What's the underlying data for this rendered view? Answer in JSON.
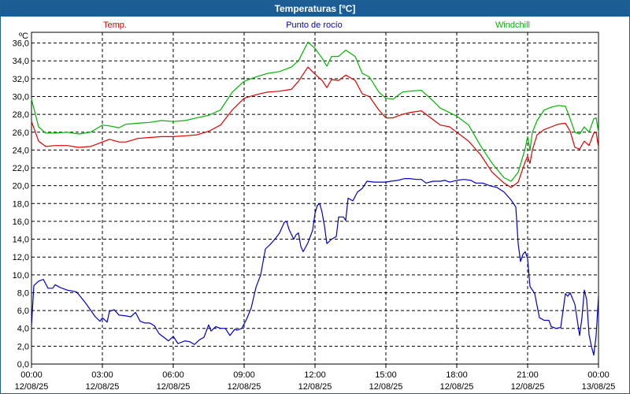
{
  "title": "Temperaturas [ºC]",
  "chart_data": {
    "type": "line",
    "yunit": "ºC",
    "ylim": [
      0,
      37.2
    ],
    "yticks": [
      "0,0",
      "2,0",
      "4,0",
      "6,0",
      "8,0",
      "10,0",
      "12,0",
      "14,0",
      "16,0",
      "18,0",
      "20,0",
      "22,0",
      "24,0",
      "26,0",
      "28,0",
      "30,0",
      "32,0",
      "34,0",
      "36,0"
    ],
    "xticks": [
      {
        "time": "00:00",
        "date": "12/08/25"
      },
      {
        "time": "03:00",
        "date": "12/08/25"
      },
      {
        "time": "06:00",
        "date": "12/08/25"
      },
      {
        "time": "09:00",
        "date": "12/08/25"
      },
      {
        "time": "12:00",
        "date": "12/08/25"
      },
      {
        "time": "15:00",
        "date": "12/08/25"
      },
      {
        "time": "18:00",
        "date": "12/08/25"
      },
      {
        "time": "21:00",
        "date": "12/08/25"
      },
      {
        "time": "00:00",
        "date": "13/08/25"
      }
    ],
    "xlim_hours": [
      0,
      24
    ],
    "grid": true,
    "series": [
      {
        "name": "Temp.",
        "color": "#e00000",
        "points": [
          [
            0,
            27.2
          ],
          [
            0.3,
            25.0
          ],
          [
            0.6,
            24.4
          ],
          [
            1.0,
            24.5
          ],
          [
            1.5,
            24.5
          ],
          [
            2.0,
            24.3
          ],
          [
            2.5,
            24.4
          ],
          [
            3.0,
            24.9
          ],
          [
            3.3,
            25.2
          ],
          [
            3.7,
            24.9
          ],
          [
            4.0,
            24.9
          ],
          [
            4.5,
            25.3
          ],
          [
            5.0,
            25.4
          ],
          [
            5.5,
            25.5
          ],
          [
            6.0,
            25.5
          ],
          [
            6.5,
            25.6
          ],
          [
            7.0,
            25.7
          ],
          [
            7.5,
            26.1
          ],
          [
            8.0,
            26.8
          ],
          [
            8.5,
            28.5
          ],
          [
            9.0,
            29.8
          ],
          [
            9.5,
            30.2
          ],
          [
            10.0,
            30.5
          ],
          [
            10.5,
            30.6
          ],
          [
            11.0,
            30.8
          ],
          [
            11.3,
            31.7
          ],
          [
            11.7,
            33.3
          ],
          [
            12.0,
            32.5
          ],
          [
            12.3,
            31.8
          ],
          [
            12.5,
            31.0
          ],
          [
            12.7,
            31.9
          ],
          [
            13.0,
            31.8
          ],
          [
            13.3,
            32.4
          ],
          [
            13.7,
            31.8
          ],
          [
            14.0,
            30.3
          ],
          [
            14.3,
            30.0
          ],
          [
            14.7,
            28.5
          ],
          [
            15.0,
            27.6
          ],
          [
            15.3,
            27.6
          ],
          [
            15.7,
            28.0
          ],
          [
            16.0,
            28.2
          ],
          [
            16.5,
            28.4
          ],
          [
            17.0,
            27.4
          ],
          [
            17.3,
            26.8
          ],
          [
            17.7,
            26.6
          ],
          [
            18.0,
            26.0
          ],
          [
            18.5,
            25.0
          ],
          [
            19.0,
            23.5
          ],
          [
            19.5,
            21.5
          ],
          [
            20.0,
            20.3
          ],
          [
            20.3,
            19.8
          ],
          [
            20.6,
            20.4
          ],
          [
            20.9,
            22.7
          ],
          [
            21.0,
            23.3
          ],
          [
            21.1,
            22.5
          ],
          [
            21.2,
            24.0
          ],
          [
            21.4,
            25.7
          ],
          [
            21.7,
            26.3
          ],
          [
            22.0,
            26.6
          ],
          [
            22.3,
            26.9
          ],
          [
            22.6,
            27.0
          ],
          [
            22.8,
            26.1
          ],
          [
            23.0,
            24.3
          ],
          [
            23.2,
            24.1
          ],
          [
            23.4,
            25.0
          ],
          [
            23.6,
            24.5
          ],
          [
            23.8,
            25.9
          ],
          [
            23.9,
            26.0
          ],
          [
            24.0,
            24.3
          ]
        ]
      },
      {
        "name": "Punto de rocío",
        "color": "#0000c8",
        "points": [
          [
            0,
            4.3
          ],
          [
            0.1,
            8.8
          ],
          [
            0.3,
            9.3
          ],
          [
            0.5,
            9.5
          ],
          [
            0.7,
            8.5
          ],
          [
            0.9,
            8.5
          ],
          [
            1.0,
            8.9
          ],
          [
            1.2,
            8.6
          ],
          [
            1.5,
            8.3
          ],
          [
            1.9,
            8.1
          ],
          [
            2.0,
            7.8
          ],
          [
            2.3,
            6.8
          ],
          [
            2.7,
            5.3
          ],
          [
            2.9,
            4.8
          ],
          [
            3.0,
            5.2
          ],
          [
            3.2,
            4.7
          ],
          [
            3.3,
            5.9
          ],
          [
            3.5,
            6.1
          ],
          [
            3.7,
            5.5
          ],
          [
            4.0,
            5.4
          ],
          [
            4.2,
            5.3
          ],
          [
            4.4,
            5.8
          ],
          [
            4.6,
            4.8
          ],
          [
            4.8,
            4.6
          ],
          [
            5.0,
            4.6
          ],
          [
            5.2,
            4.3
          ],
          [
            5.4,
            3.4
          ],
          [
            5.6,
            3.0
          ],
          [
            5.8,
            2.6
          ],
          [
            6.0,
            3.1
          ],
          [
            6.2,
            2.3
          ],
          [
            6.5,
            2.6
          ],
          [
            6.7,
            2.5
          ],
          [
            6.9,
            2.2
          ],
          [
            7.1,
            2.7
          ],
          [
            7.3,
            3.0
          ],
          [
            7.5,
            4.4
          ],
          [
            7.6,
            3.7
          ],
          [
            7.8,
            4.2
          ],
          [
            8.0,
            4.0
          ],
          [
            8.2,
            4.0
          ],
          [
            8.4,
            3.2
          ],
          [
            8.6,
            3.9
          ],
          [
            8.7,
            3.8
          ],
          [
            8.9,
            4.0
          ],
          [
            9.1,
            5.0
          ],
          [
            9.3,
            6.3
          ],
          [
            9.5,
            8.6
          ],
          [
            9.7,
            10.0
          ],
          [
            9.9,
            12.9
          ],
          [
            10.1,
            13.4
          ],
          [
            10.3,
            14.0
          ],
          [
            10.5,
            14.7
          ],
          [
            10.7,
            15.9
          ],
          [
            10.8,
            16.0
          ],
          [
            10.9,
            15.1
          ],
          [
            11.1,
            14.0
          ],
          [
            11.2,
            14.5
          ],
          [
            11.3,
            14.7
          ],
          [
            11.4,
            13.2
          ],
          [
            11.5,
            12.6
          ],
          [
            11.7,
            13.6
          ],
          [
            11.9,
            15.0
          ],
          [
            12.0,
            16.9
          ],
          [
            12.1,
            17.8
          ],
          [
            12.2,
            18.0
          ],
          [
            12.3,
            17.0
          ],
          [
            12.4,
            15.5
          ],
          [
            12.5,
            13.5
          ],
          [
            12.7,
            14.0
          ],
          [
            12.9,
            14.3
          ],
          [
            13.0,
            16.5
          ],
          [
            13.2,
            16.5
          ],
          [
            13.3,
            16.1
          ],
          [
            13.4,
            18.6
          ],
          [
            13.6,
            18.3
          ],
          [
            13.8,
            19.3
          ],
          [
            14.0,
            19.7
          ],
          [
            14.2,
            20.5
          ],
          [
            14.5,
            20.4
          ],
          [
            14.8,
            20.4
          ],
          [
            15.0,
            20.4
          ],
          [
            15.2,
            20.5
          ],
          [
            15.5,
            20.6
          ],
          [
            15.8,
            20.8
          ],
          [
            16.0,
            20.8
          ],
          [
            16.3,
            20.7
          ],
          [
            16.5,
            20.7
          ],
          [
            16.7,
            20.3
          ],
          [
            17.0,
            20.5
          ],
          [
            17.3,
            20.5
          ],
          [
            17.5,
            20.6
          ],
          [
            17.7,
            20.4
          ],
          [
            18.0,
            20.6
          ],
          [
            18.3,
            20.7
          ],
          [
            18.6,
            20.6
          ],
          [
            18.8,
            20.3
          ],
          [
            19.1,
            20.3
          ],
          [
            19.4,
            20.0
          ],
          [
            19.7,
            19.8
          ],
          [
            20.0,
            19.3
          ],
          [
            20.3,
            18.4
          ],
          [
            20.5,
            17.6
          ],
          [
            20.6,
            13.5
          ],
          [
            20.7,
            11.5
          ],
          [
            20.8,
            12.3
          ],
          [
            20.9,
            12.6
          ],
          [
            21.0,
            11.8
          ],
          [
            21.1,
            8.7
          ],
          [
            21.3,
            7.9
          ],
          [
            21.5,
            5.2
          ],
          [
            21.7,
            4.9
          ],
          [
            21.9,
            4.9
          ],
          [
            22.0,
            4.2
          ],
          [
            22.2,
            4.0
          ],
          [
            22.4,
            4.1
          ],
          [
            22.6,
            7.9
          ],
          [
            22.7,
            7.6
          ],
          [
            22.8,
            8.0
          ],
          [
            23.0,
            6.7
          ],
          [
            23.2,
            3.2
          ],
          [
            23.3,
            5.2
          ],
          [
            23.4,
            8.3
          ],
          [
            23.5,
            7.2
          ],
          [
            23.6,
            3.3
          ],
          [
            23.7,
            2.0
          ],
          [
            23.8,
            1.0
          ],
          [
            23.9,
            3.2
          ],
          [
            24.0,
            7.6
          ]
        ]
      },
      {
        "name": "Windchill",
        "color": "#00b400",
        "points": [
          [
            0,
            29.7
          ],
          [
            0.3,
            26.6
          ],
          [
            0.6,
            25.9
          ],
          [
            1.0,
            25.9
          ],
          [
            1.5,
            26.0
          ],
          [
            2.0,
            25.8
          ],
          [
            2.5,
            26.0
          ],
          [
            3.0,
            26.8
          ],
          [
            3.3,
            26.7
          ],
          [
            3.7,
            26.5
          ],
          [
            4.0,
            26.9
          ],
          [
            4.5,
            27.0
          ],
          [
            5.0,
            27.1
          ],
          [
            5.5,
            27.3
          ],
          [
            6.0,
            27.2
          ],
          [
            6.5,
            27.3
          ],
          [
            7.0,
            27.6
          ],
          [
            7.5,
            27.9
          ],
          [
            8.0,
            28.5
          ],
          [
            8.5,
            30.5
          ],
          [
            9.0,
            31.7
          ],
          [
            9.5,
            32.2
          ],
          [
            10.0,
            32.6
          ],
          [
            10.5,
            32.8
          ],
          [
            11.0,
            33.3
          ],
          [
            11.3,
            34.0
          ],
          [
            11.7,
            36.1
          ],
          [
            12.0,
            35.4
          ],
          [
            12.3,
            34.3
          ],
          [
            12.5,
            33.4
          ],
          [
            12.7,
            34.5
          ],
          [
            13.0,
            34.5
          ],
          [
            13.3,
            35.2
          ],
          [
            13.7,
            34.5
          ],
          [
            14.0,
            32.6
          ],
          [
            14.3,
            32.2
          ],
          [
            14.7,
            30.5
          ],
          [
            15.0,
            29.8
          ],
          [
            15.3,
            29.7
          ],
          [
            15.7,
            30.5
          ],
          [
            16.0,
            30.6
          ],
          [
            16.5,
            30.7
          ],
          [
            17.0,
            29.5
          ],
          [
            17.3,
            28.7
          ],
          [
            17.7,
            28.2
          ],
          [
            18.0,
            27.8
          ],
          [
            18.5,
            26.8
          ],
          [
            19.0,
            24.5
          ],
          [
            19.5,
            22.5
          ],
          [
            20.0,
            20.9
          ],
          [
            20.3,
            20.5
          ],
          [
            20.6,
            21.5
          ],
          [
            20.9,
            24.2
          ],
          [
            21.0,
            25.5
          ],
          [
            21.1,
            24.0
          ],
          [
            21.2,
            26.0
          ],
          [
            21.4,
            27.3
          ],
          [
            21.7,
            28.5
          ],
          [
            22.0,
            28.8
          ],
          [
            22.3,
            29.0
          ],
          [
            22.6,
            28.9
          ],
          [
            22.8,
            27.5
          ],
          [
            23.0,
            26.0
          ],
          [
            23.2,
            25.8
          ],
          [
            23.4,
            26.6
          ],
          [
            23.6,
            26.0
          ],
          [
            23.8,
            27.5
          ],
          [
            23.9,
            27.6
          ],
          [
            24.0,
            26.0
          ]
        ]
      }
    ]
  }
}
